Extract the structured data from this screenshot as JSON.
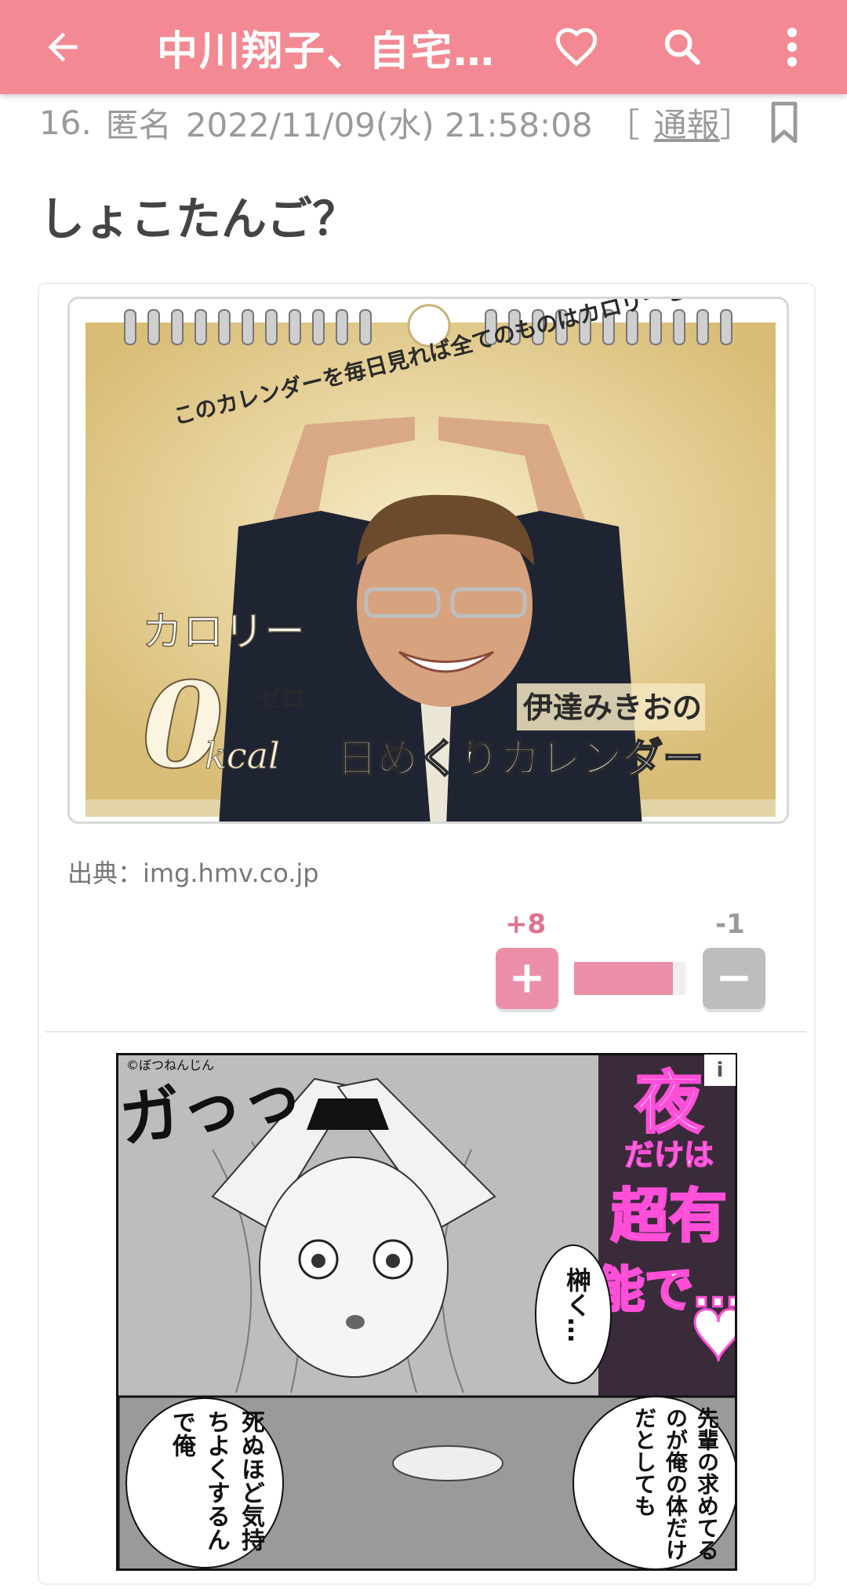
{
  "appbar": {
    "title": "中川翔子、自宅…",
    "icons": [
      "back-arrow-icon",
      "heart-icon",
      "search-icon",
      "more-vert-icon"
    ]
  },
  "comment": {
    "number": "16.",
    "author": "匿名",
    "datetime": "2022/11/09(水) 21:58:08",
    "report_open": "［",
    "report_label": "通報",
    "report_close": "］",
    "body": "しょこたんご？",
    "source": "出典：img.hmv.co.jp"
  },
  "calendar_image": {
    "banner": "このカレンダーを毎日見れば全てのものはカロリーゼロ!!",
    "calorie": "カロリー",
    "zero": "0",
    "zero_ruby": "ゼロ",
    "kcal": "kcal",
    "owner": "伊達みきおの",
    "product": "日めくりカレンダー"
  },
  "votes": {
    "plus": "+8",
    "minus": "-1",
    "plus_icon": "plus-icon",
    "minus_icon": "minus-icon",
    "plus_ratio": 0.89
  },
  "ad": {
    "info": "i",
    "credit": "©ぼつねんじん",
    "sfx": "ガっっ",
    "title_1": "夜",
    "title_2": "だけは",
    "title_3": "超有",
    "title_4": "能で…",
    "speech_1": "榊く…",
    "speech_2": "死ぬほど気持ちよくするんで俺",
    "speech_3": "先輩の求めてるのが俺の体だけだとしても"
  },
  "colors": {
    "appbar": "#f38a93",
    "accent_pink": "#ea8fa7",
    "minus_gray": "#bdbdbd"
  }
}
